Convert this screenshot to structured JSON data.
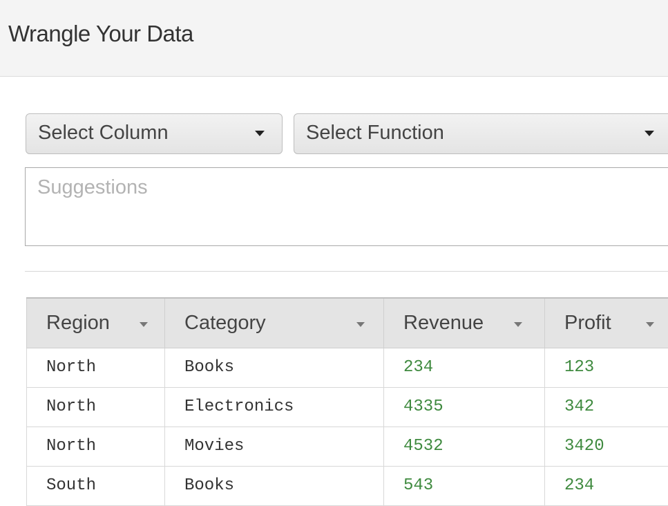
{
  "header": {
    "title": "Wrangle Your Data"
  },
  "controls": {
    "column_select": {
      "selected": "Select Column"
    },
    "function_select": {
      "selected": "Select Function"
    },
    "suggestions": {
      "placeholder": "Suggestions"
    }
  },
  "table": {
    "columns": [
      "Region",
      "Category",
      "Revenue",
      "Profit"
    ],
    "rows": [
      [
        "North",
        "Books",
        "234",
        "123"
      ],
      [
        "North",
        "Electronics",
        "4335",
        "342"
      ],
      [
        "North",
        "Movies",
        "4532",
        "3420"
      ],
      [
        "South",
        "Books",
        "543",
        "234"
      ]
    ]
  },
  "colors": {
    "numeric_text": "#3f8a3f",
    "header_bg": "#e4e4e4"
  }
}
